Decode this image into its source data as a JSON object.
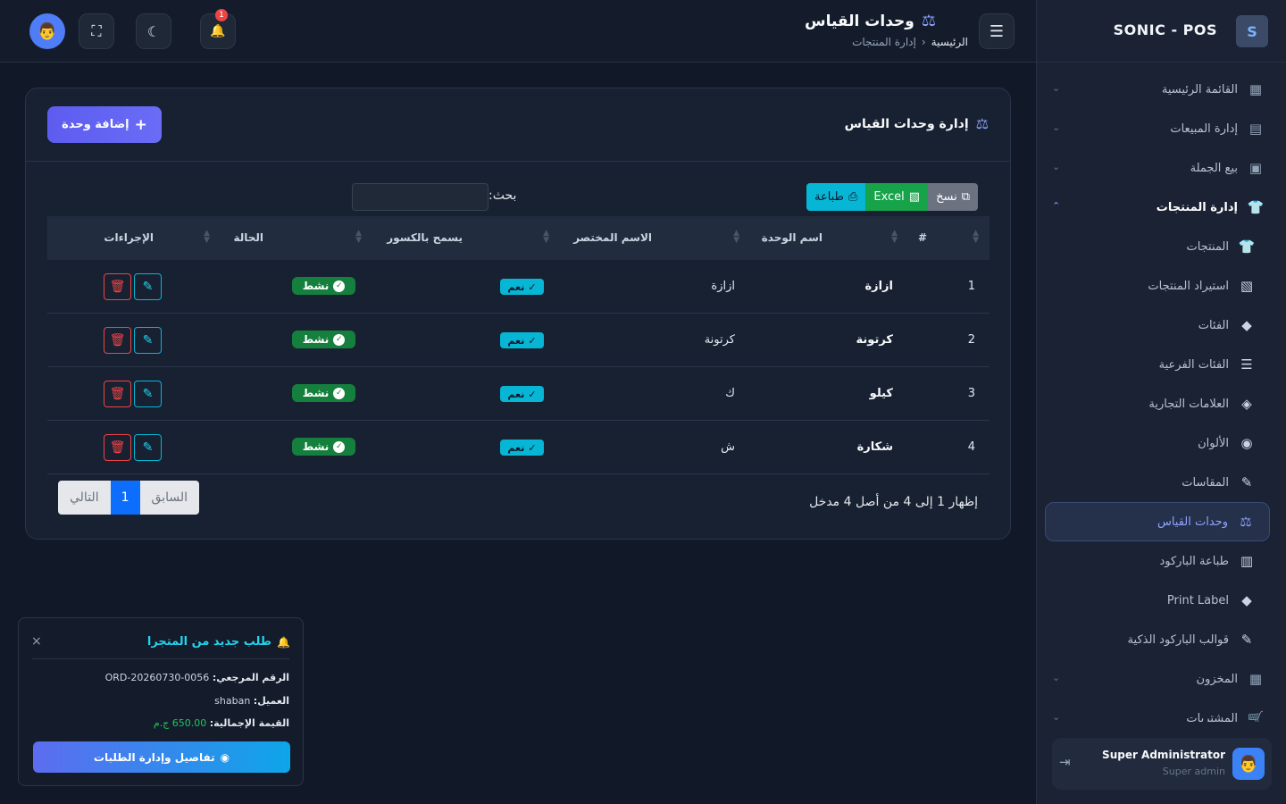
{
  "brand": {
    "name": "SONIC - POS",
    "logo_letter": "S"
  },
  "sidebar": {
    "items": [
      {
        "label": "القائمة الرئيسية",
        "icon": "dashboard-icon",
        "glyph": "▦",
        "chev": "⌄"
      },
      {
        "label": "إدارة المبيعات",
        "icon": "cash-register-icon",
        "glyph": "▤",
        "chev": "⌄"
      },
      {
        "label": "بيع الجملة",
        "icon": "boxes-icon",
        "glyph": "▣",
        "chev": "⌄"
      },
      {
        "label": "إدارة المنتجات",
        "icon": "shirt-icon",
        "glyph": "👕",
        "chev": "⌃"
      }
    ],
    "sub_items": [
      {
        "label": "المنتجات",
        "icon": "shirt-icon",
        "glyph": "👕"
      },
      {
        "label": "استيراد المنتجات",
        "icon": "csv-file-icon",
        "glyph": "▧"
      },
      {
        "label": "الفئات",
        "icon": "tags-icon",
        "glyph": "◆"
      },
      {
        "label": "الفئات الفرعية",
        "icon": "list-icon",
        "glyph": "☰"
      },
      {
        "label": "العلامات التجارية",
        "icon": "gem-icon",
        "glyph": "◈"
      },
      {
        "label": "الألوان",
        "icon": "palette-icon",
        "glyph": "◉"
      },
      {
        "label": "المقاسات",
        "icon": "ruler-icon",
        "glyph": "✎"
      },
      {
        "label": "وحدات القياس",
        "icon": "scale-icon",
        "glyph": "⚖"
      },
      {
        "label": "طباعة الباركود",
        "icon": "barcode-icon",
        "glyph": "▥"
      },
      {
        "label": "Print Label",
        "icon": "tags-icon",
        "glyph": "◆"
      },
      {
        "label": "قوالب الباركود الذكية",
        "icon": "pen-icon",
        "glyph": "✎"
      }
    ],
    "bottom_items": [
      {
        "label": "المخزون",
        "icon": "warehouse-icon",
        "glyph": "▦",
        "chev": "⌄"
      },
      {
        "label": "المشتريات",
        "icon": "cart-icon",
        "glyph": "🛒",
        "chev": "⌄"
      }
    ]
  },
  "user": {
    "name": "Super Administrator",
    "role": "Super admin",
    "logout_glyph": "⇥"
  },
  "header": {
    "title": "وحدات القياس",
    "crumb_home": "الرئيسية",
    "crumb_sep": "‹",
    "crumb_current": "إدارة المنتجات",
    "menu_glyph": "☰",
    "bell_count": "1",
    "bell_glyph": "🔔",
    "moon_glyph": "☾",
    "expand_glyph": "⛶",
    "avatar_glyph": "👨"
  },
  "card": {
    "title": "إدارة وحدات القياس",
    "add_label": "إضافة وحدة",
    "add_glyph": "+",
    "scale_glyph": "⚖"
  },
  "toolbar": {
    "copy": "نسخ",
    "excel": "Excel",
    "print": "طباعة"
  },
  "search": {
    "label": "بحث:",
    "value": ""
  },
  "table": {
    "columns": [
      "#",
      "اسم الوحدة",
      "الاسم المختصر",
      "يسمح بالكسور",
      "الحالة",
      "الإجراءات"
    ],
    "rows": [
      {
        "num": "1",
        "name": "ازازة",
        "short": "ازازة",
        "fraction": "نعم",
        "status": "نشط"
      },
      {
        "num": "2",
        "name": "كرتونة",
        "short": "كرتونة",
        "fraction": "نعم",
        "status": "نشط"
      },
      {
        "num": "3",
        "name": "كيلو",
        "short": "ك",
        "fraction": "نعم",
        "status": "نشط"
      },
      {
        "num": "4",
        "name": "شكارة",
        "short": "ش",
        "fraction": "نعم",
        "status": "نشط"
      }
    ]
  },
  "footer": {
    "info": "إظهار 1 إلى 4 من أصل 4 مدخل",
    "prev": "السابق",
    "page": "1",
    "next": "التالي"
  },
  "toast": {
    "title": "طلب جديد من المتجرا",
    "ref_label": "الرقم المرجعي:",
    "ref_value": "ORD-20260730-0056",
    "customer_label": "العميل:",
    "customer_value": "shaban",
    "total_label": "القيمة الإجمالية:",
    "total_value": "650.00 ج.م",
    "button": "تفاصيل وإدارة الطلبات",
    "close": "×"
  },
  "colors": {
    "accent": "#6366f1",
    "cyan": "#06b6d4",
    "success": "#15803d",
    "danger": "#ef4444"
  }
}
